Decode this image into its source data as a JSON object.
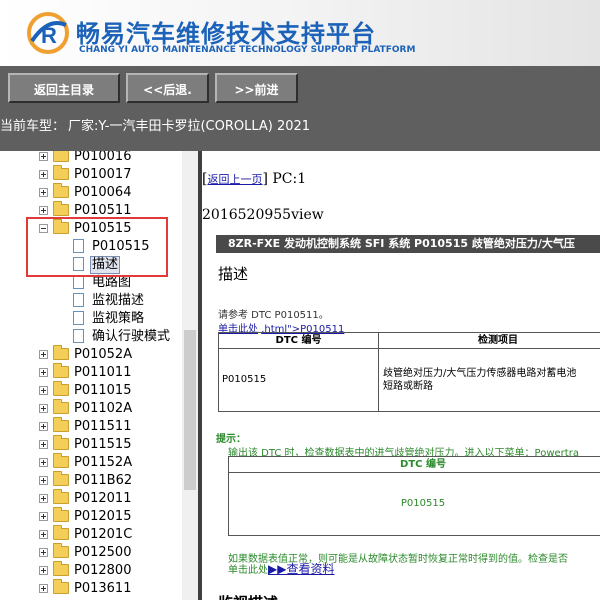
{
  "header": {
    "title_cn": "畅易汽车维修技术支持平台",
    "title_en": "CHANG YI AUTO MAINTENANCE TECHNOLOGY SUPPORT PLATFORM"
  },
  "toolbar": {
    "home_label": "返回主目录",
    "back_label": "<<后退.",
    "forward_label": ">>前进"
  },
  "vehicle": {
    "label": "当前车型：",
    "value": "厂家:Y-一汽丰田卡罗拉(COROLLA) 2021"
  },
  "tree": {
    "items": [
      {
        "label": "P010016"
      },
      {
        "label": "P010017"
      },
      {
        "label": "P010064"
      },
      {
        "label": "P010511"
      },
      {
        "label": "P010515"
      },
      {
        "label": "P010515"
      },
      {
        "label": "描述"
      },
      {
        "label": "电路图"
      },
      {
        "label": "监视描述"
      },
      {
        "label": "监视策略"
      },
      {
        "label": "确认行驶模式"
      },
      {
        "label": "P01052A"
      },
      {
        "label": "P011011"
      },
      {
        "label": "P011015"
      },
      {
        "label": "P01102A"
      },
      {
        "label": "P011511"
      },
      {
        "label": "P011515"
      },
      {
        "label": "P01152A"
      },
      {
        "label": "P011B62"
      },
      {
        "label": "P012011"
      },
      {
        "label": "P012015"
      },
      {
        "label": "P01201C"
      },
      {
        "label": "P012500"
      },
      {
        "label": "P012800"
      },
      {
        "label": "P013611"
      }
    ]
  },
  "content": {
    "back_link": "返回上一页",
    "pc_text": "] PC:1",
    "bracket_open": "[",
    "view_id": "2016520955view",
    "system_bar": "8ZR-FXE 发动机控制系统  SFI 系统  P010515  歧管绝对压力/大气压",
    "heading": "描述",
    "ref_text": "请参考 DTC P010511。",
    "link1_prefix": "单击此处",
    "link1_text": ".html\">P010511",
    "table1": {
      "headers": [
        "DTC 编号",
        "检测项目"
      ],
      "dtc": "P010515",
      "detect_line1": "歧管绝对压力/大气压力传感器电路对蓄电池",
      "detect_line2": "短路或断路"
    },
    "hint_label": "提示：",
    "hint_text": "输出该 DTC 时，检查数据表中的进气歧管绝对压力。进入以下菜单：Powertra",
    "table2": {
      "header": "DTC 编号",
      "dtc": "P010515"
    },
    "note": "如果数据表值正常，则可能是从故障状态暂时恢复正常时得到的值。检查是否",
    "link2_prefix": "单击此处",
    "link2_text": "▶▶查看资料",
    "next_heading": "监视描述"
  }
}
